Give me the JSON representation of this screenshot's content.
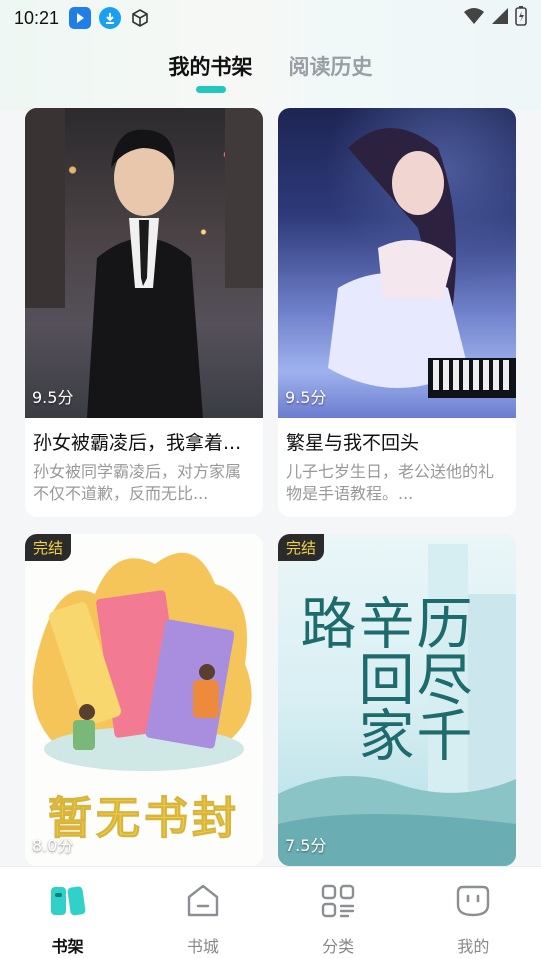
{
  "status_bar": {
    "time": "10:21"
  },
  "tabs": [
    {
      "label": "我的书架",
      "active": true
    },
    {
      "label": "阅读历史",
      "active": false
    }
  ],
  "books": [
    {
      "title": "孙女被霸凌后，我拿着...",
      "desc": "孙女被同学霸凌后，对方家属不仅不道歉，反而无比...",
      "score": "9.5分",
      "badge": ""
    },
    {
      "title": "繁星与我不回头",
      "desc": "儿子七岁生日，老公送他的礼物是手语教程。...",
      "score": "9.5分",
      "badge": ""
    },
    {
      "title": "",
      "desc": "",
      "score": "8.0分",
      "badge": "完结",
      "cover_text": "暂无书封"
    },
    {
      "title": "",
      "desc": "",
      "score": "7.5分",
      "badge": "完结",
      "cover_text": "历尽千辛回家路"
    }
  ],
  "bottom_nav": [
    {
      "label": "书架",
      "icon": "bookshelf-icon",
      "active": true
    },
    {
      "label": "书城",
      "icon": "bookstore-icon",
      "active": false
    },
    {
      "label": "分类",
      "icon": "category-icon",
      "active": false
    },
    {
      "label": "我的",
      "icon": "profile-icon",
      "active": false
    }
  ],
  "colors": {
    "accent": "#22c7c0",
    "badge_text": "#f3d24a",
    "badge_bg": "#2b2b2b"
  }
}
